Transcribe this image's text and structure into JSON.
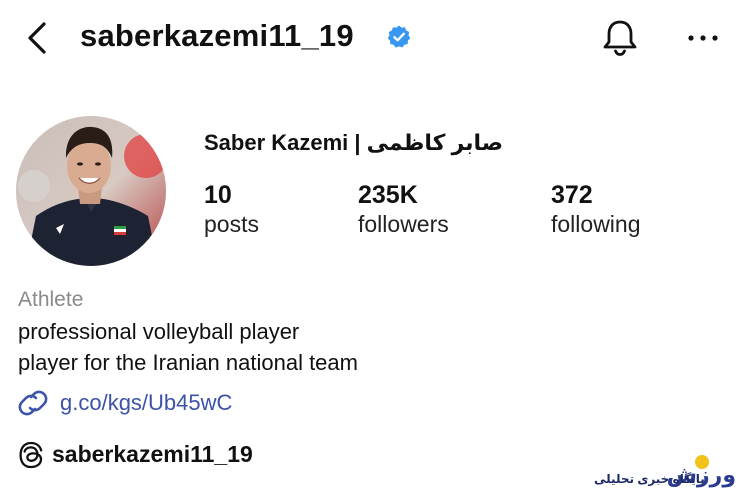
{
  "header": {
    "username": "saberkazemi11_19",
    "back_icon": "chevron-left-icon",
    "verified_icon": "verified-badge-icon",
    "notifications_icon": "bell-icon",
    "more_icon": "more-horizontal-icon"
  },
  "profile": {
    "display_name": "Saber Kazemi | صابر کاظمی",
    "stats": [
      {
        "value": "10",
        "label": "posts"
      },
      {
        "value": "235K",
        "label": "followers"
      },
      {
        "value": "372",
        "label": "following"
      }
    ],
    "category": "Athlete",
    "bio_lines": [
      "professional volleyball player",
      "player for the Iranian national team"
    ],
    "link": "g.co/kgs/Ub45wC",
    "threads_handle": "saberkazemi11_19"
  },
  "watermark": {
    "logo_text": "ورزش",
    "tagline": "پایگاه خبری تحلیلی"
  },
  "colors": {
    "verified_blue": "#3897f0",
    "link_blue": "#3c53a8",
    "category_gray": "#8a8a8a",
    "text": "#111111"
  }
}
